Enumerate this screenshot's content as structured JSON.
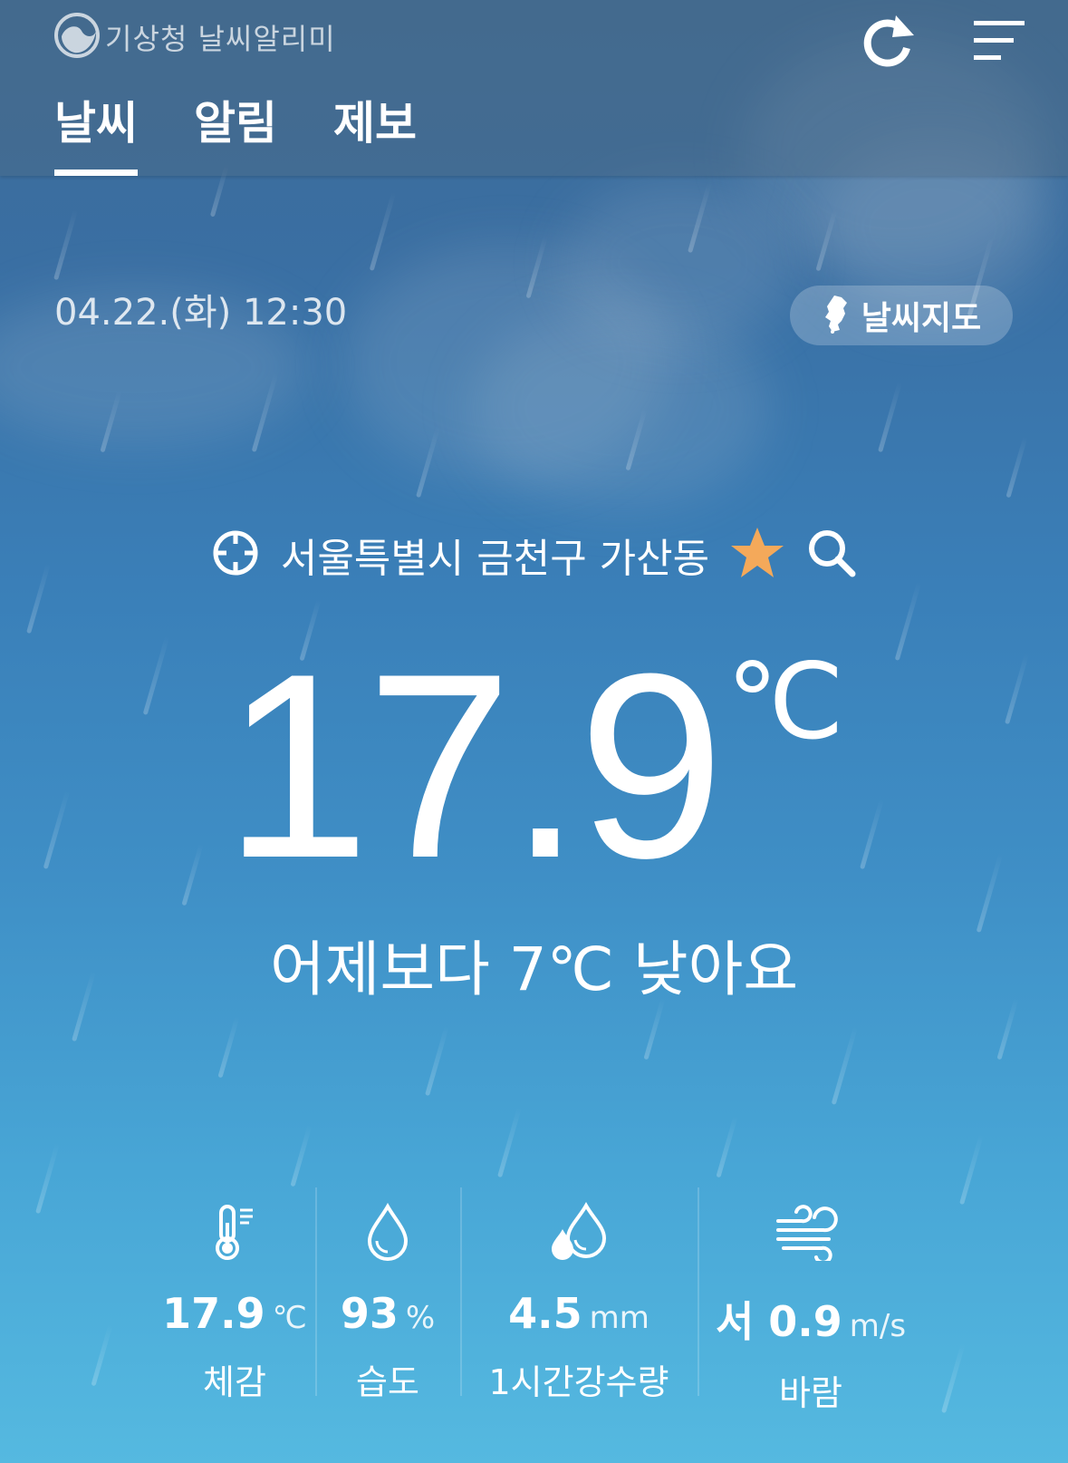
{
  "app": {
    "title": "기상청 날씨알리미"
  },
  "header": {
    "refresh_icon": "refresh-icon",
    "menu_icon": "menu-icon",
    "tabs": [
      {
        "label": "날씨",
        "active": true
      },
      {
        "label": "알림",
        "active": false
      },
      {
        "label": "제보",
        "active": false
      }
    ]
  },
  "main": {
    "datetime": "04.22.(화) 12:30",
    "weather_map_button": "날씨지도",
    "location": "서울특별시 금천구 가산동",
    "temperature": "17.9",
    "temperature_unit": "℃",
    "comparison": "어제보다 7℃ 낮아요",
    "favorite_color": "#f4a95a"
  },
  "stats": [
    {
      "icon": "thermometer-icon",
      "value": "17.9",
      "unit": "℃",
      "label": "체감"
    },
    {
      "icon": "droplet-icon",
      "value": "93",
      "unit": "%",
      "label": "습도"
    },
    {
      "icon": "rain-drops-icon",
      "value": "4.5",
      "unit": "mm",
      "label": "1시간강수량"
    },
    {
      "icon": "wind-icon",
      "value": "서 0.9",
      "unit": "m/s",
      "label": "바람"
    }
  ]
}
